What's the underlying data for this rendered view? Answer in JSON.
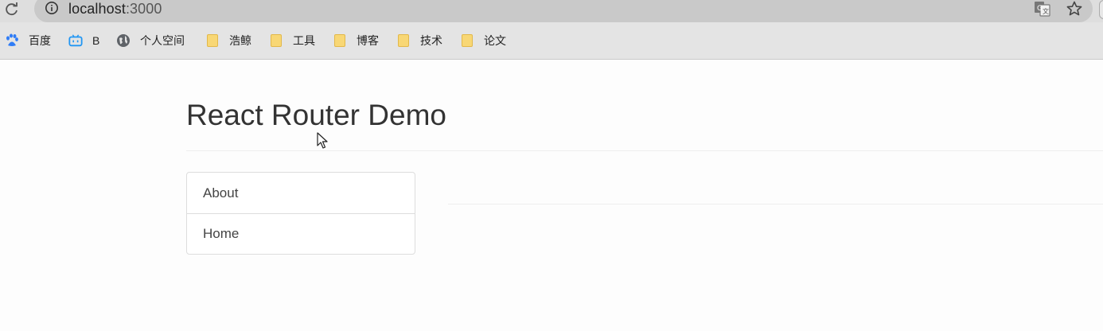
{
  "browser": {
    "url_host": "localhost",
    "url_port": ":3000",
    "icons": [
      "reload-icon",
      "site-info-icon",
      "translate-icon",
      "bookmark-star-icon"
    ]
  },
  "bookmarks": [
    {
      "label": "百度",
      "icon": "paw-icon"
    },
    {
      "label": "B",
      "icon": "tv-icon"
    },
    {
      "label": "个人空间",
      "icon": "globe-icon"
    },
    {
      "label": "浩鲸",
      "icon": "folder-icon"
    },
    {
      "label": "工具",
      "icon": "folder-icon"
    },
    {
      "label": "博客",
      "icon": "folder-icon"
    },
    {
      "label": "技术",
      "icon": "folder-icon"
    },
    {
      "label": "论文",
      "icon": "folder-icon"
    }
  ],
  "page": {
    "title": "React Router Demo",
    "nav": [
      {
        "label": "About"
      },
      {
        "label": "Home"
      }
    ]
  },
  "colors": {
    "folder": "#f8d775",
    "bilibili": "#2196f3",
    "baidu": "#2f7cf6"
  }
}
